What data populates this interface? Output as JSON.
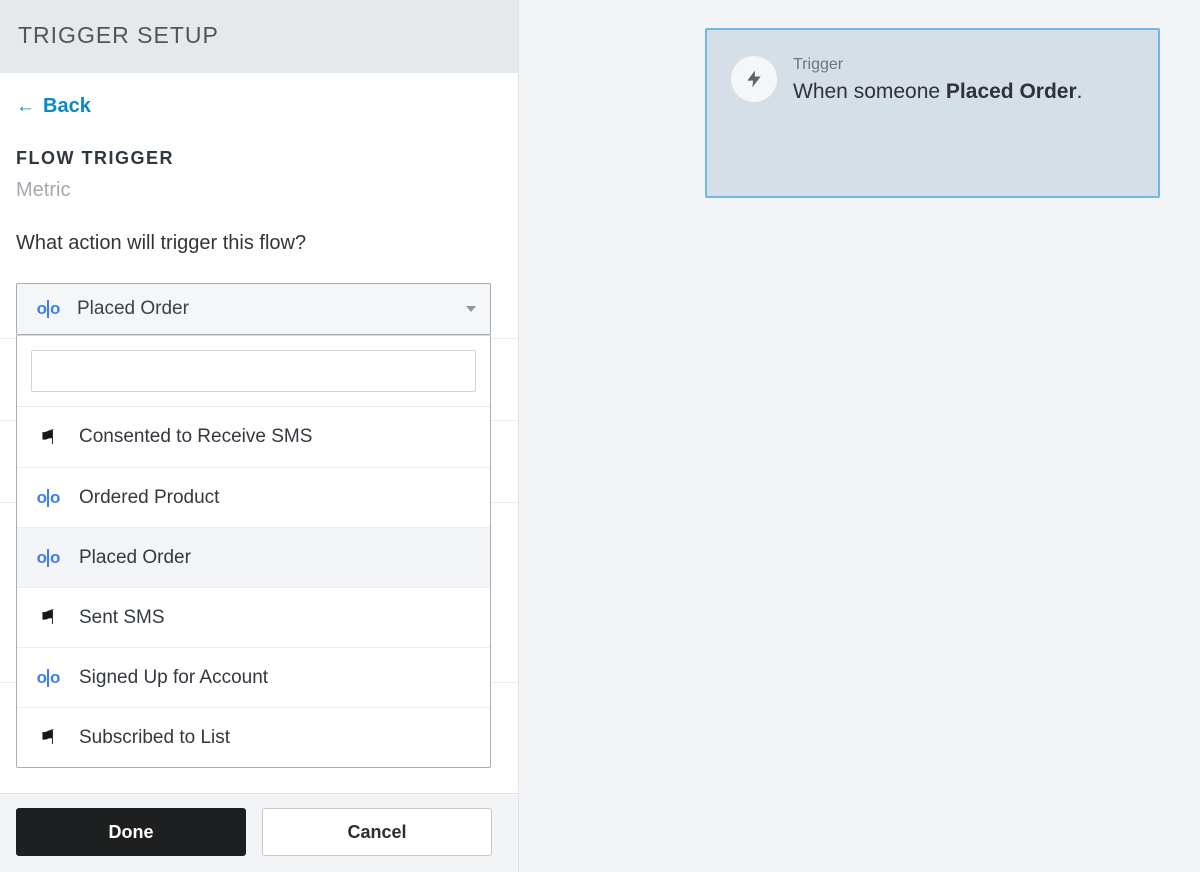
{
  "panel": {
    "title": "TRIGGER SETUP",
    "back_label": "Back",
    "section_label": "FLOW TRIGGER",
    "subtype": "Metric",
    "question": "What action will trigger this flow?"
  },
  "select": {
    "selected_label": "Placed Order",
    "selected_icon": "olo",
    "search_value": "",
    "options": [
      {
        "label": "Consented to Receive SMS",
        "icon": "flag",
        "selected": false
      },
      {
        "label": "Ordered Product",
        "icon": "olo",
        "selected": false
      },
      {
        "label": "Placed Order",
        "icon": "olo",
        "selected": true
      },
      {
        "label": "Sent SMS",
        "icon": "flag",
        "selected": false
      },
      {
        "label": "Signed Up for Account",
        "icon": "olo",
        "selected": false
      },
      {
        "label": "Subscribed to List",
        "icon": "flag",
        "selected": false
      }
    ]
  },
  "footer": {
    "done": "Done",
    "cancel": "Cancel"
  },
  "canvas": {
    "trigger_kicker": "Trigger",
    "sentence_prefix": "When someone ",
    "sentence_strong": "Placed Order",
    "sentence_suffix": "."
  }
}
